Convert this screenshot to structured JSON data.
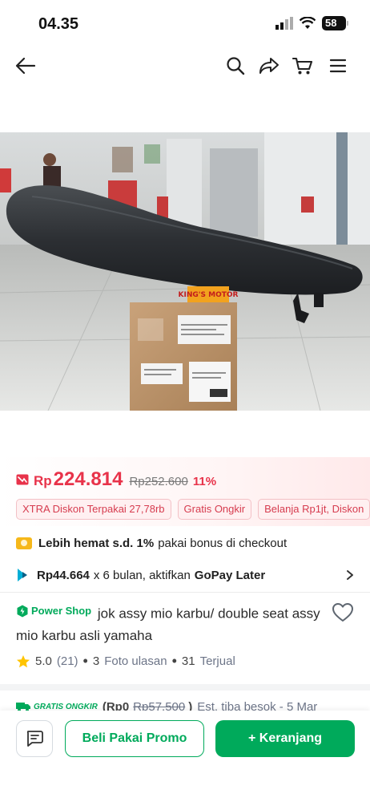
{
  "status_bar": {
    "time": "04.35",
    "battery": "58"
  },
  "nav": {
    "back_icon": "arrow-left-icon",
    "search_icon": "search-icon",
    "share_icon": "share-icon",
    "cart_icon": "cart-icon",
    "menu_icon": "hamburger-menu-icon"
  },
  "product_image": {
    "sticker_text": "KING'S MOTOR"
  },
  "price": {
    "currency": "Rp",
    "value": "224.814",
    "original": "Rp252.600",
    "discount": "11%"
  },
  "chips": [
    "XTRA Diskon Terpakai 27,78rb",
    "Gratis Ongkir",
    "Belanja Rp1jt, Diskon"
  ],
  "bonus": {
    "bold": "Lebih hemat s.d. 1%",
    "text": "pakai bonus di checkout"
  },
  "installment": {
    "amount": "Rp44.664",
    "text": "x 6 bulan, aktifkan",
    "brand": "GoPay Later"
  },
  "shop_badge": "Power Shop",
  "title": "jok assy mio karbu/ double seat assy mio karbu asli yamaha",
  "rating": {
    "score": "5.0",
    "count": "(21)",
    "photos": "3",
    "photos_label": "Foto ulasan",
    "sold": "31",
    "sold_label": "Terjual"
  },
  "shipping": {
    "badge": "GRATIS ONGKIR",
    "price": "(Rp0",
    "old": "Rp57.500",
    "close": ")",
    "eta": "Est. tiba besok - 5 Mar"
  },
  "actions": {
    "promo": "Beli Pakai Promo",
    "cart": "+ Keranjang"
  },
  "colors": {
    "accent_green": "#00aa5b",
    "price_red": "#e8334a"
  }
}
